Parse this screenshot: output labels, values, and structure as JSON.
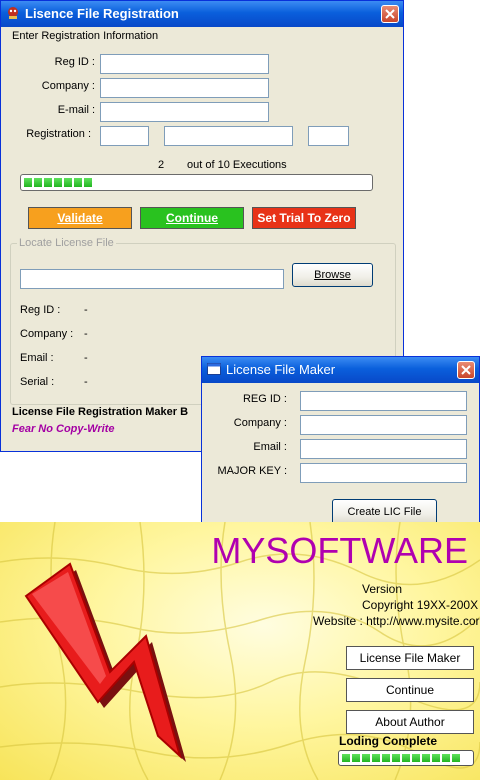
{
  "reg_window": {
    "title": "Lisence File Registration",
    "group_title": "Enter Registration Information",
    "reg_id_label": "Reg ID :",
    "company_label": "Company :",
    "email_label": "E-mail :",
    "registration_label": "Registration :",
    "executions_count": "2",
    "executions_text": "out of 10 Executions",
    "progress_fraction": 0.2,
    "validate_label": "Validate",
    "continue_label": "Continue",
    "set_trial_label": "Set Trial To Zero",
    "locate_group_title": "Locate License File",
    "browse_label": "Browse",
    "info_reg_id_label": "Reg ID :",
    "info_reg_id_value": "-",
    "info_company_label": "Company :",
    "info_company_value": "-",
    "info_email_label": "Email :",
    "info_email_value": "-",
    "info_serial_label": "Serial :",
    "info_serial_value": "-",
    "footer_title": "License File Registration Maker B",
    "footer_tagline": "Fear No Copy-Write",
    "colors": {
      "validate": "#f7a01e",
      "continue": "#29c21f",
      "set_trial": "#e83217",
      "tagline": "#a400a4"
    }
  },
  "maker_window": {
    "title": "License File Maker",
    "reg_id_label": "REG ID :",
    "company_label": "Company :",
    "email_label": "Email :",
    "major_key_label": "MAJOR KEY :",
    "create_button_label": "Create LIC File"
  },
  "splash": {
    "title": "MYSOFTWARE",
    "version_text": "Version",
    "copyright_text": "Copyright 19XX-200X",
    "website_text": "Website : http://www.mysite.cor",
    "license_button_label": "License File Maker",
    "continue_button_label": "Continue",
    "about_button_label": "About Author",
    "loading_text": "Loding Complete",
    "loading_fraction": 1.0,
    "title_color": "#b000b0",
    "logo_icon": "red-lightning-bolt-icon"
  }
}
